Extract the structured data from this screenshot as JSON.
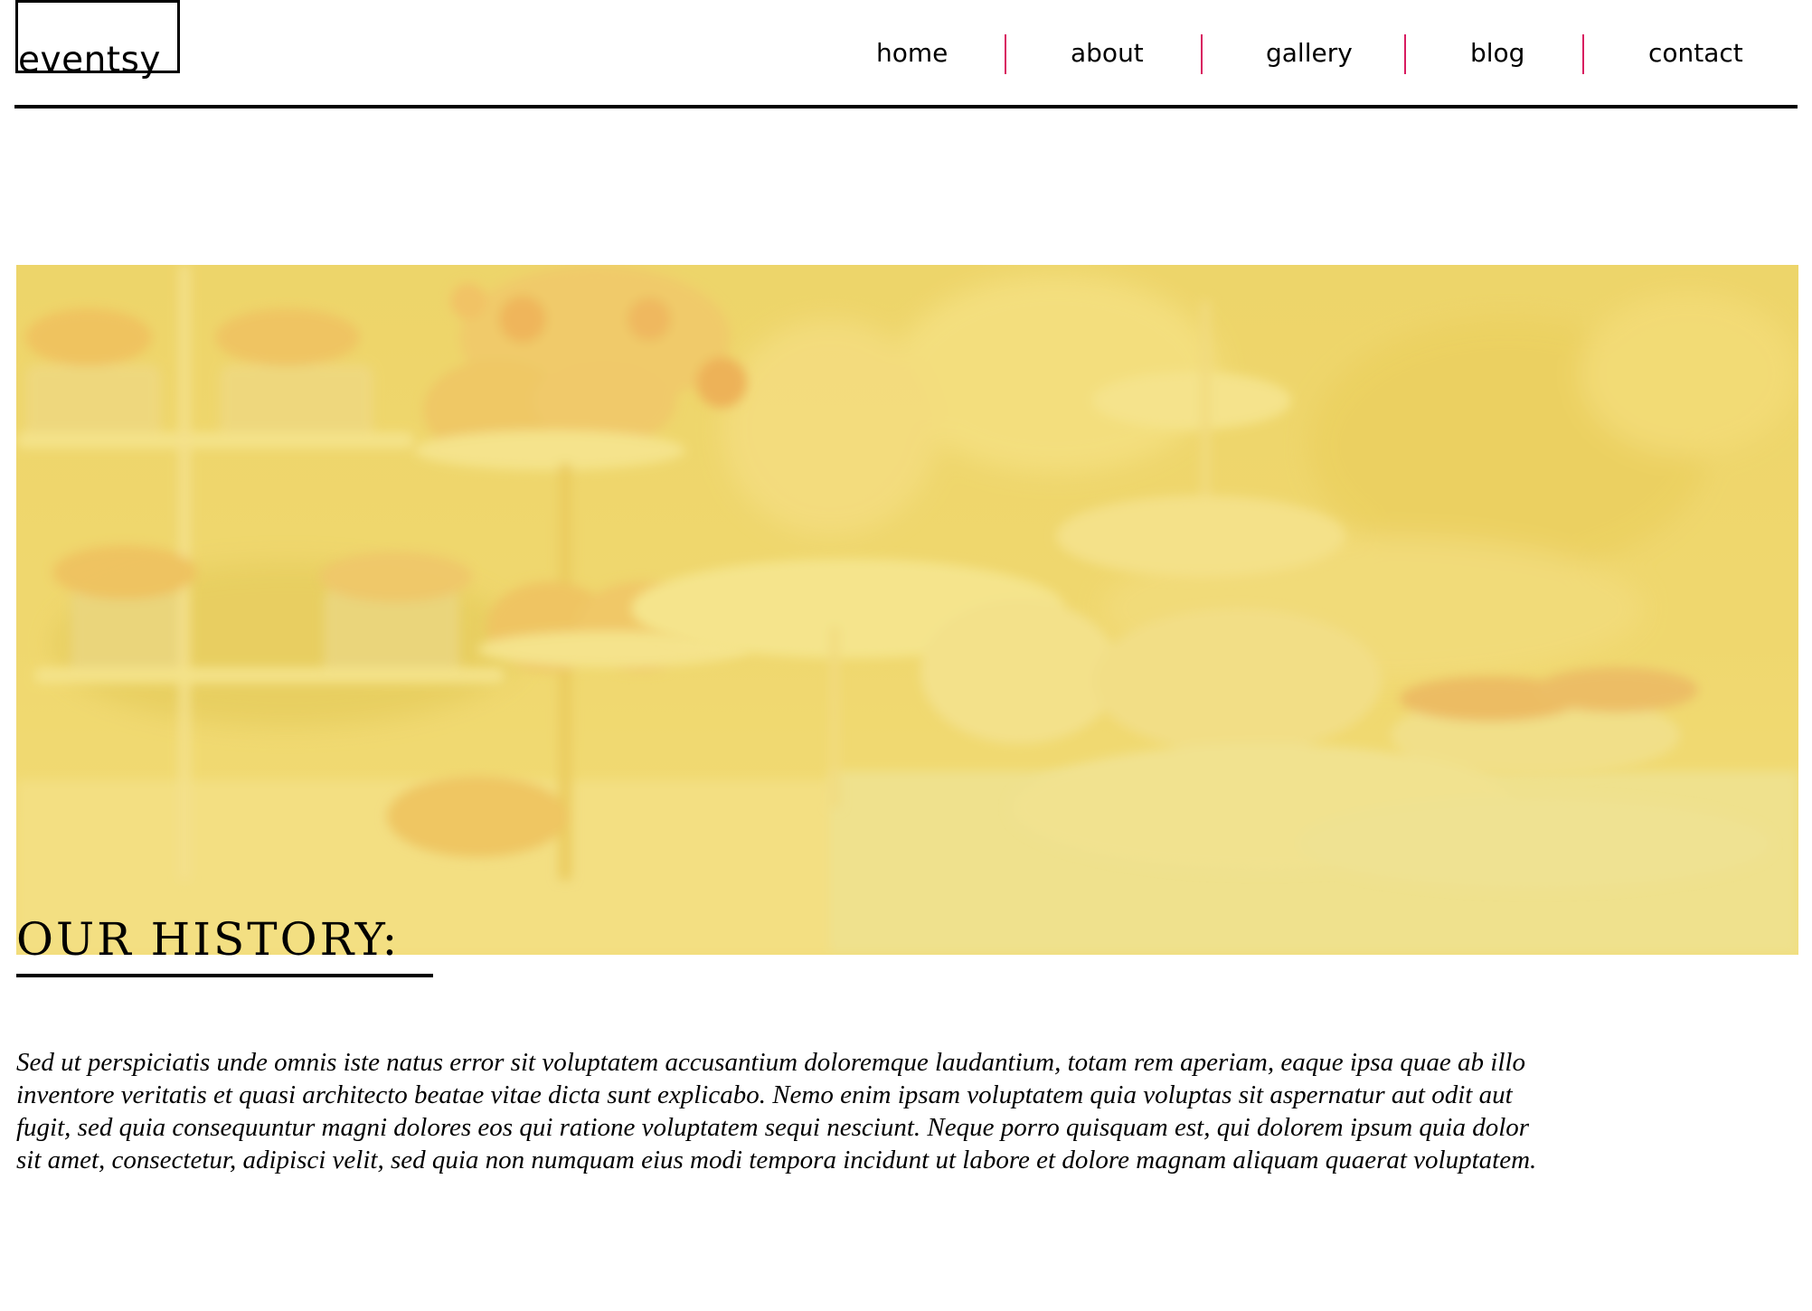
{
  "brand": {
    "logo_text": "eventsy"
  },
  "nav": {
    "items": [
      {
        "id": "home",
        "label": "home"
      },
      {
        "id": "about",
        "label": "about"
      },
      {
        "id": "gallery",
        "label": "gallery"
      },
      {
        "id": "blog",
        "label": "blog"
      },
      {
        "id": "contact",
        "label": "contact"
      }
    ],
    "separator_color": "#d81b60"
  },
  "hero": {
    "overlay_color": "#f2d66b"
  },
  "history": {
    "heading": "OUR HISTORY:",
    "body": "Sed ut perspiciatis unde omnis iste natus error sit voluptatem accusantium doloremque laudantium, totam rem aperiam, eaque ipsa quae ab illo inventore veritatis et quasi architecto beatae vitae dicta sunt explicabo. Nemo enim ipsam voluptatem quia voluptas sit aspernatur aut odit aut fugit, sed quia consequuntur magni dolores eos qui ratione voluptatem sequi nesciunt. Neque porro quisquam est, qui dolorem ipsum quia dolor sit amet, consectetur, adipisci velit, sed quia non numquam eius modi tempora incidunt ut labore et dolore magnam aliquam quaerat voluptatem."
  }
}
